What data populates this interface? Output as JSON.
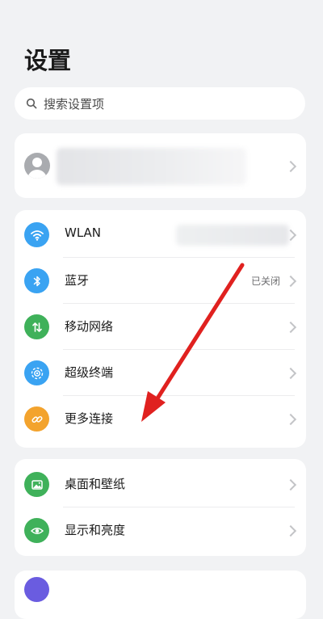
{
  "page": {
    "title": "设置"
  },
  "search": {
    "placeholder": "搜索设置项",
    "icon": "search-icon"
  },
  "connectivity": [
    {
      "label": "WLAN",
      "status": "",
      "icon": "wifi-icon",
      "color": "#3aa3f2"
    },
    {
      "label": "蓝牙",
      "status": "已关闭",
      "icon": "bluetooth-icon",
      "color": "#3aa3f2"
    },
    {
      "label": "移动网络",
      "status": "",
      "icon": "mobile-network-icon",
      "color": "#3fb15a"
    },
    {
      "label": "超级终端",
      "status": "",
      "icon": "super-device-icon",
      "color": "#3aa3f2"
    },
    {
      "label": "更多连接",
      "status": "",
      "icon": "link-icon",
      "color": "#f3a32d"
    }
  ],
  "display": [
    {
      "label": "桌面和壁纸",
      "icon": "wallpaper-icon",
      "color": "#3fb15a"
    },
    {
      "label": "显示和亮度",
      "icon": "eye-icon",
      "color": "#3fb15a"
    }
  ],
  "annotation": {
    "color": "#e0211f"
  }
}
